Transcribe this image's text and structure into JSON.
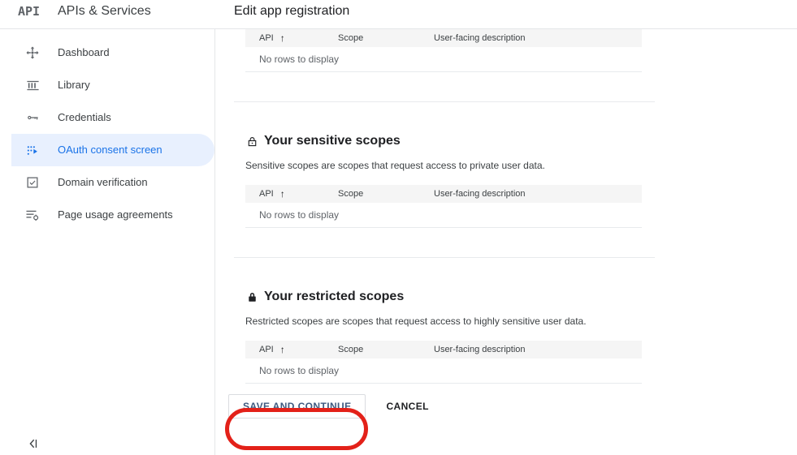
{
  "header": {
    "logo_text": "API",
    "product_title": "APIs & Services",
    "page_title": "Edit app registration"
  },
  "sidebar": {
    "items": [
      {
        "label": "Dashboard",
        "icon": "dashboard-icon",
        "selected": false
      },
      {
        "label": "Library",
        "icon": "library-icon",
        "selected": false
      },
      {
        "label": "Credentials",
        "icon": "key-icon",
        "selected": false
      },
      {
        "label": "OAuth consent screen",
        "icon": "oauth-consent-icon",
        "selected": true
      },
      {
        "label": "Domain verification",
        "icon": "verified-checkbox-icon",
        "selected": false
      },
      {
        "label": "Page usage agreements",
        "icon": "page-usage-agreements-icon",
        "selected": false
      }
    ],
    "collapse_icon": "chevron-left-panel-icon"
  },
  "table_columns": {
    "api": "API",
    "scope": "Scope",
    "description": "User-facing description",
    "sort_indicator": "↑"
  },
  "empty_row_text": "No rows to display",
  "sections": [
    {
      "id": "non-sensitive-scopes",
      "title": "",
      "description": "",
      "lock": "none"
    },
    {
      "id": "sensitive-scopes",
      "title": "Your sensitive scopes",
      "description": "Sensitive scopes are scopes that request access to private user data.",
      "lock": "lock-outline-icon"
    },
    {
      "id": "restricted-scopes",
      "title": "Your restricted scopes",
      "description": "Restricted scopes are scopes that request access to highly sensitive user data.",
      "lock": "lock-filled-icon"
    }
  ],
  "actions": {
    "save_label": "SAVE AND CONTINUE",
    "cancel_label": "CANCEL"
  },
  "annotation": {
    "shape": "rounded-rect-highlight",
    "color": "#e32119",
    "target": "SAVE AND CONTINUE"
  },
  "colors": {
    "accent": "#1a73e8",
    "selected_bg": "#e8f0fe",
    "table_header_bg": "#f5f5f5",
    "text_primary": "#3c4043",
    "annotation_red": "#e32119"
  }
}
